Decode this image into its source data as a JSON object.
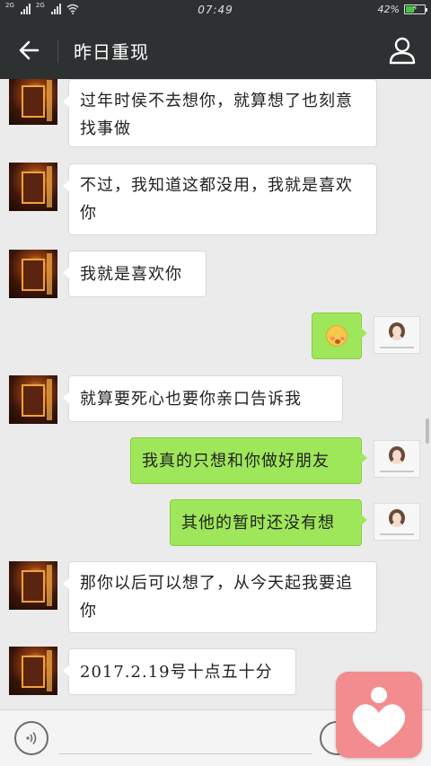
{
  "status_bar": {
    "sim1": "2G",
    "sim2": "2G",
    "time": "07:49",
    "battery_percent": "42%"
  },
  "header": {
    "title": "昨日重现"
  },
  "messages": [
    {
      "side": "in",
      "text": "过年时侯不去想你，就算想了也刻意找事做"
    },
    {
      "side": "in",
      "text": "不过，我知道这都没用，我就是喜欢你"
    },
    {
      "side": "in",
      "text": "我就是喜欢你"
    },
    {
      "side": "out",
      "text": "",
      "sticker": "blushing-face-emoji"
    },
    {
      "side": "in",
      "text": "就算要死心也要你亲口告诉我"
    },
    {
      "side": "out",
      "text": "我真的只想和你做好朋友"
    },
    {
      "side": "out",
      "text": "其他的暂时还没有想"
    },
    {
      "side": "in",
      "text": "那你以后可以想了，从今天起我要追你"
    },
    {
      "side": "in",
      "text": "2017.2.19号十点五十分"
    }
  ],
  "colors": {
    "header_bg": "#2e3132",
    "chat_bg": "#ebebeb",
    "outgoing_bubble": "#9fe75a",
    "incoming_bubble": "#ffffff",
    "floating_app": "#f38c8e"
  }
}
